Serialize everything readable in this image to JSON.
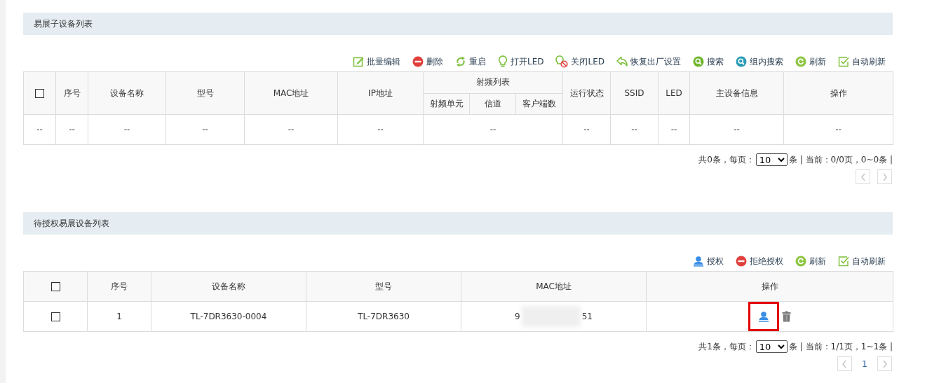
{
  "sections": [
    {
      "title": "易展子设备列表",
      "toolbar": [
        {
          "label": "批量编辑"
        },
        {
          "label": "删除"
        },
        {
          "label": "重启"
        },
        {
          "label": "打开LED"
        },
        {
          "label": "关闭LED"
        },
        {
          "label": "恢复出厂设置"
        },
        {
          "label": "搜索"
        },
        {
          "label": "组内搜索"
        },
        {
          "label": "刷新"
        },
        {
          "label": "自动刷新"
        }
      ],
      "table": {
        "columns": [
          {
            "kind": "checkbox",
            "checked": false
          },
          {
            "label": "序号"
          },
          {
            "label": "设备名称"
          },
          {
            "label": "型号"
          },
          {
            "label": "MAC地址"
          },
          {
            "label": "IP地址"
          },
          {
            "label": "射频列表",
            "children": [
              {
                "label": "射频单元"
              },
              {
                "label": "信道"
              },
              {
                "label": "客户端数"
              }
            ]
          },
          {
            "label": "运行状态"
          },
          {
            "label": "SSID"
          },
          {
            "label": "LED"
          },
          {
            "label": "主设备信息"
          },
          {
            "label": "操作"
          }
        ],
        "rows": [
          {
            "cells": [
              {
                "kind": "text",
                "text": "--"
              },
              {
                "kind": "text",
                "text": "--"
              },
              {
                "kind": "text",
                "text": "--"
              },
              {
                "kind": "text",
                "text": "--"
              },
              {
                "kind": "text",
                "text": "--"
              },
              {
                "kind": "text",
                "text": "--"
              },
              {
                "kind": "text",
                "text": "--"
              },
              {
                "kind": "text",
                "text": "--"
              },
              {
                "kind": "text",
                "text": "--"
              },
              {
                "kind": "text",
                "text": "--"
              },
              {
                "kind": "text",
                "text": "--"
              },
              {
                "kind": "text",
                "text": "--"
              }
            ]
          }
        ]
      },
      "pagination": {
        "summary": "共0条，每页：",
        "page_size": "10",
        "status": "条 | 当前：0/0页，0~0条 |"
      }
    },
    {
      "title": "待授权易展设备列表",
      "toolbar": [
        {
          "label": "授权"
        },
        {
          "label": "拒绝授权"
        },
        {
          "label": "刷新"
        },
        {
          "label": "自动刷新"
        }
      ],
      "table": {
        "columns": [
          {
            "kind": "checkbox",
            "checked": false
          },
          {
            "label": "序号"
          },
          {
            "label": "设备名称"
          },
          {
            "label": "型号"
          },
          {
            "label": "MAC地址"
          },
          {
            "label": "操作"
          }
        ],
        "rows": [
          {
            "cells": [
              {
                "kind": "checkbox",
                "checked": false
              },
              {
                "kind": "text",
                "text": "1"
              },
              {
                "kind": "text",
                "text": "TL-7DR3630-0004"
              },
              {
                "kind": "text",
                "text": "TL-7DR3630"
              },
              {
                "kind": "mac",
                "start": "9",
                "end": "51"
              },
              {
                "kind": "actions",
                "actions": [
                  {
                    "highlighted": true
                  },
                  {
                    "highlighted": false
                  }
                ]
              }
            ]
          }
        ]
      },
      "pagination": {
        "summary": "共1条，每页：",
        "page_size": "10",
        "status": "条 | 当前：1/1页，1~1条 |",
        "pages": [
          "1"
        ]
      }
    }
  ]
}
